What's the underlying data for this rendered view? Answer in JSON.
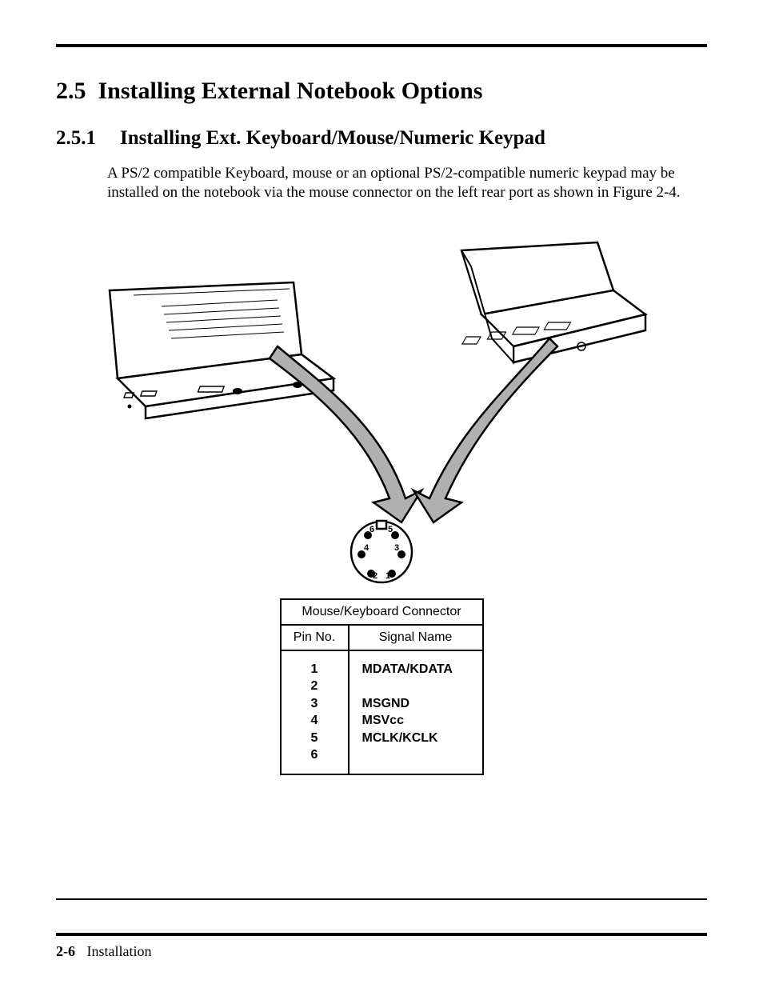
{
  "section": {
    "number": "2.5",
    "title": "Installing External Notebook Options"
  },
  "subsection": {
    "number": "2.5.1",
    "title": "Installing Ext. Keyboard/Mouse/Numeric Keypad"
  },
  "paragraph": "A PS/2 compatible Keyboard, mouse or an optional PS/2-compatible numeric keypad may be installed on the notebook via the mouse connector on the  left rear port as shown in Figure 2-4.",
  "connector": {
    "pin_labels": [
      "1",
      "2",
      "3",
      "4",
      "5",
      "6"
    ]
  },
  "table": {
    "title": "Mouse/Keyboard Connector",
    "col_pin": "Pin No.",
    "col_signal": "Signal Name",
    "rows": [
      {
        "pin": "1",
        "signal": "MDATA/KDATA"
      },
      {
        "pin": "2",
        "signal": ""
      },
      {
        "pin": "3",
        "signal": "MSGND"
      },
      {
        "pin": "4",
        "signal": "MSVcc"
      },
      {
        "pin": "5",
        "signal": "MCLK/KCLK"
      },
      {
        "pin": "6",
        "signal": ""
      }
    ]
  },
  "footer": {
    "page": "2-6",
    "chapter": "Installation"
  }
}
